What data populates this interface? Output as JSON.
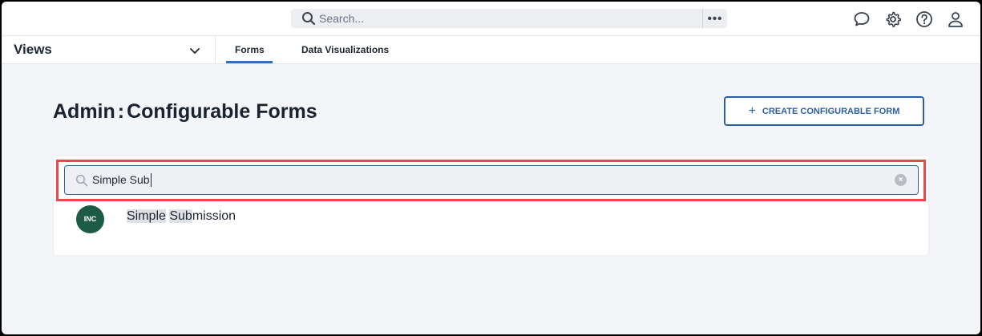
{
  "topbar": {
    "search_placeholder": "Search...",
    "more_label": "•••",
    "icons": [
      "chat-icon",
      "gear-icon",
      "help-icon",
      "user-icon"
    ]
  },
  "views": {
    "label": "Views",
    "tabs": [
      {
        "label": "Forms",
        "active": true
      },
      {
        "label": "Data Visualizations",
        "active": false
      }
    ]
  },
  "page": {
    "title_part1": "Admin",
    "title_separator": ":",
    "title_part2": "Configurable Forms",
    "create_button_label": "CREATE CONFIGURABLE FORM"
  },
  "search": {
    "value": "Simple Sub"
  },
  "results": [
    {
      "avatar": "INC",
      "name_match1": "Simple",
      "name_space": " ",
      "name_match2": "Sub",
      "name_rest": "mission"
    }
  ],
  "colors": {
    "accent": "#2b5ea5",
    "highlight_border": "#e8474c",
    "avatar_bg": "#1d5b47"
  }
}
